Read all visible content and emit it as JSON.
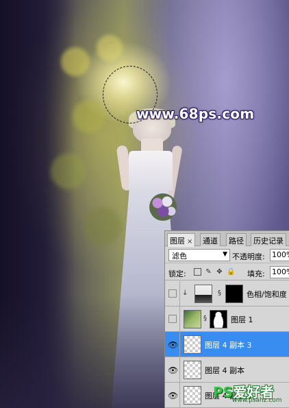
{
  "watermark": {
    "text": "www.68ps.com"
  },
  "layers_panel": {
    "tabs": [
      {
        "label": "图层",
        "active": true,
        "close": "×"
      },
      {
        "label": "通道",
        "active": false
      },
      {
        "label": "路径",
        "active": false
      },
      {
        "label": "历史记录",
        "active": false
      }
    ],
    "blend_mode": "滤色",
    "opacity_label": "不透明度:",
    "opacity_value": "100%",
    "lock_label": "锁定:",
    "fill_label": "填充:",
    "fill_value": "100%",
    "layers": [
      {
        "name": "色相/饱和度",
        "visible": false,
        "selected": false,
        "thumb": "adjustment",
        "mask": "black",
        "clipped": true
      },
      {
        "name": "图层 1",
        "visible": false,
        "selected": false,
        "thumb": "photo",
        "mask": "figure"
      },
      {
        "name": "图层 4 副本 3",
        "visible": true,
        "selected": true,
        "thumb": "transparent"
      },
      {
        "name": "图层 4 副本",
        "visible": true,
        "selected": false,
        "thumb": "transparent"
      },
      {
        "name": "图层 4 副本 2",
        "visible": true,
        "selected": false,
        "thumb": "transparent"
      }
    ]
  },
  "logo": {
    "ps": "PS",
    "text": "爱好者",
    "url": "www.psahz.com"
  },
  "colors": {
    "selection": "#3a8df0",
    "panel_bg": "#d6d6d6",
    "watermark_outline": "#2c1c6a",
    "logo_green": "#35c445"
  }
}
